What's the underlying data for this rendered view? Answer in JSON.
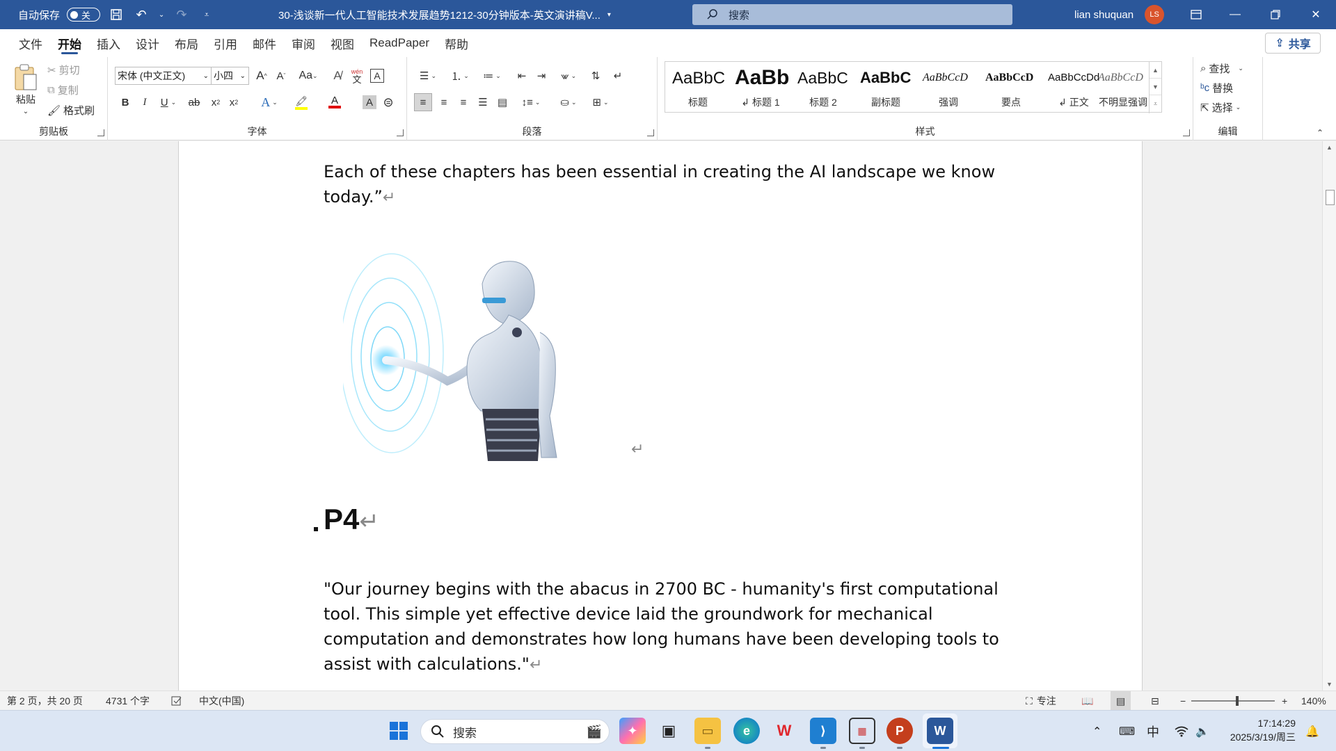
{
  "titlebar": {
    "autosave_label": "自动保存",
    "autosave_state": "关",
    "doc_title": "30-浅谈新一代人工智能技术发展趋势1212-30分钟版本-英文演讲稿V...",
    "search_placeholder": "搜索",
    "user_name": "lian shuquan",
    "user_initials": "LS"
  },
  "tabs": [
    "文件",
    "开始",
    "插入",
    "设计",
    "布局",
    "引用",
    "邮件",
    "审阅",
    "视图",
    "ReadPaper",
    "帮助"
  ],
  "active_tab": "开始",
  "share_label": "共享",
  "clipboard": {
    "paste": "粘贴",
    "cut": "剪切",
    "copy": "复制",
    "format_painter": "格式刷",
    "group_label": "剪贴板"
  },
  "font": {
    "font_name": "宋体 (中文正文)",
    "font_size": "小四",
    "group_label": "字体",
    "grow": "A",
    "shrink": "A",
    "change_case": "Aa",
    "pinyin_top": "wén",
    "pinyin_bottom": "文",
    "char_border": "A",
    "bold": "B",
    "italic": "I",
    "underline": "U",
    "strike": "ab",
    "subscript": "x",
    "superscript": "x",
    "text_effect": "A",
    "font_color": "A",
    "char_shading": "A",
    "highlight_color": "#ffff00",
    "font_color_value": "#e00000"
  },
  "paragraph": {
    "group_label": "段落"
  },
  "styles": {
    "group_label": "样式",
    "items": [
      {
        "sample": "AaBbC",
        "name": "标题"
      },
      {
        "sample": "AaBb",
        "name": "↲ 标题 1"
      },
      {
        "sample": "AaBbC",
        "name": "标题 2"
      },
      {
        "sample": "AaBbC",
        "name": "副标题"
      },
      {
        "sample": "AaBbCcD",
        "name": "强调"
      },
      {
        "sample": "AaBbCcD",
        "name": "要点"
      },
      {
        "sample": "AaBbCcDd",
        "name": "↲ 正文"
      },
      {
        "sample": "AaBbCcD",
        "name": "不明显强调"
      }
    ]
  },
  "editing": {
    "find": "查找",
    "replace": "替换",
    "select": "选择",
    "group_label": "编辑"
  },
  "document": {
    "para1": "Each of these chapters has been essential in creating the AI landscape we know today.”",
    "heading": "P4",
    "para2": "\"Our journey begins with the abacus in 2700 BC - humanity's first computational tool. This simple yet effective device laid the groundwork for mechanical computation and demonstrates how long humans have been developing tools to assist with calculations.\"",
    "return_mark": "↵"
  },
  "statusbar": {
    "page": "第 2 页，共 20 页",
    "words": "4731 个字",
    "language": "中文(中国)",
    "focus": "专注",
    "zoom": "140%",
    "zoom_level_fraction": 0.55
  },
  "taskbar": {
    "search_placeholder": "搜索",
    "ime": "中",
    "time": "17:14:29",
    "date": "2025/3/19/周三"
  },
  "colors": {
    "title_blue": "#2b579a",
    "powerpoint": "#c43e1c",
    "word": "#2b579a",
    "wps": "#e0282e"
  }
}
